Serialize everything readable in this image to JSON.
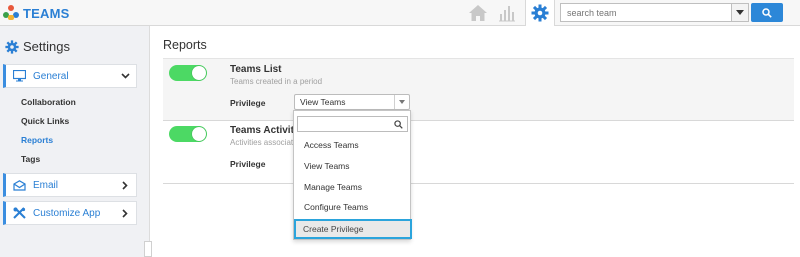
{
  "app": {
    "name": "TEAMS"
  },
  "search": {
    "placeholder": "search team"
  },
  "sidebar": {
    "title": "Settings",
    "groups": [
      {
        "label": "General",
        "icon": "monitor-icon"
      },
      {
        "label": "Email",
        "icon": "envelope-icon"
      },
      {
        "label": "Customize App",
        "icon": "wrench-icon"
      }
    ],
    "subitems": [
      "Collaboration",
      "Quick Links",
      "Reports",
      "Tags"
    ],
    "active_subitem": "Reports"
  },
  "main": {
    "title": "Reports",
    "reports": [
      {
        "name": "Teams List",
        "description": "Teams created in a period",
        "privilege_label": "Privilege",
        "privilege_value": "View Teams",
        "enabled": true
      },
      {
        "name": "Teams Activities",
        "description": "Activities associated",
        "privilege_label": "Privilege",
        "privilege_value": "",
        "enabled": true
      }
    ]
  },
  "dropdown": {
    "options": [
      "Access Teams",
      "View Teams",
      "Manage Teams",
      "Configure Teams"
    ],
    "create_label": "Create Privilege"
  },
  "colors": {
    "accent": "#2a7fd4",
    "toggle_on": "#4cd964",
    "highlight": "#2ba4dc"
  }
}
